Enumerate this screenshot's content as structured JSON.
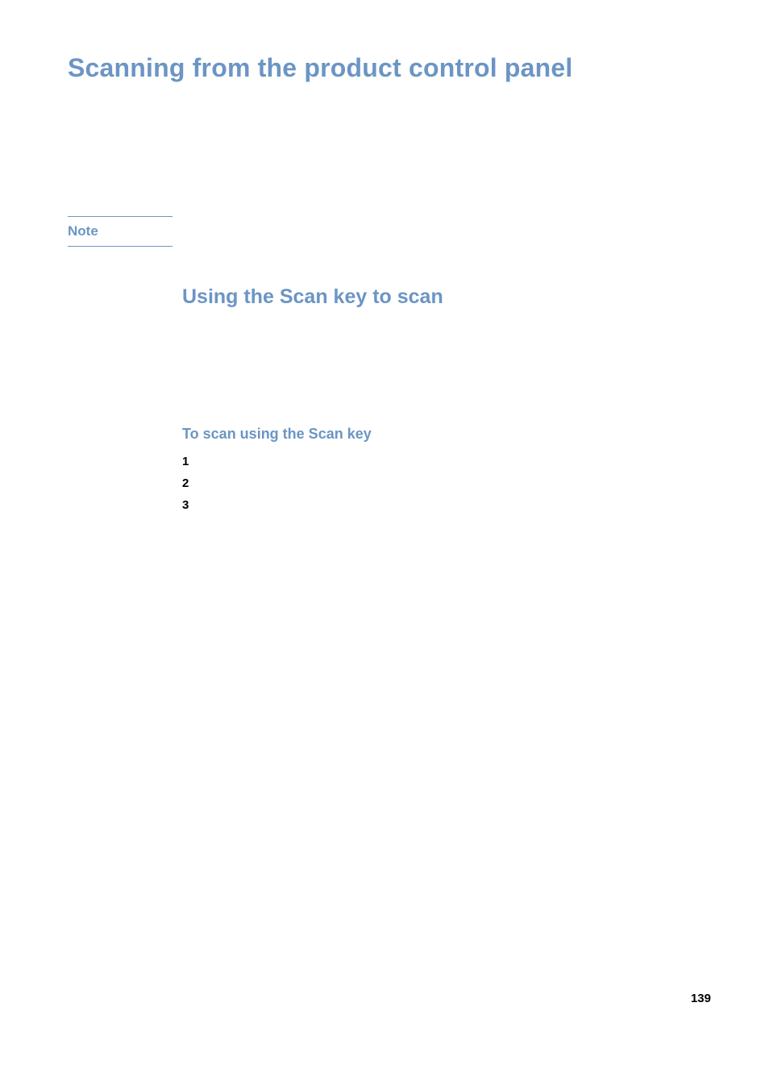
{
  "headings": {
    "h1": "Scanning from the product control panel",
    "h2": "Using the Scan key to scan",
    "h3": "To scan using the Scan key"
  },
  "note": {
    "label": "Note"
  },
  "steps": [
    "1",
    "2",
    "3"
  ],
  "pageNumber": "139"
}
